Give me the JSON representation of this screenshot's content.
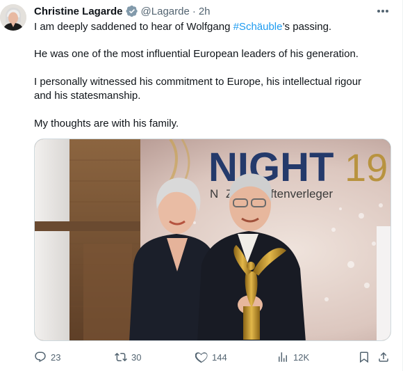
{
  "author": {
    "display_name": "Christine Lagarde",
    "handle": "@Lagarde",
    "separator": "·",
    "time": "2h",
    "avatar_icon": "profile-photo",
    "verified_icon": "verified-badge-icon",
    "verified_color": "#829aab"
  },
  "tweet": {
    "line1_pre": "I am deeply saddened to hear of Wolfgang ",
    "line1_hashtag": "#Schäuble",
    "line1_post": "’s passing.",
    "paragraph2": "He was one of the most influential European leaders of his generation.",
    "paragraph3": "I personally witnessed his commitment to Europe, his intellectual rigour and his statesmanship.",
    "paragraph4": "My thoughts are with his family."
  },
  "media": {
    "banner_word": "NIGHT",
    "banner_number": "19",
    "banner_subtext": "Zeitschriftenverleger",
    "banner_partial": "N"
  },
  "actions": {
    "replies": "23",
    "retweets": "30",
    "likes": "144",
    "views": "12K"
  },
  "colors": {
    "text": "#0f1419",
    "secondary": "#536471",
    "link": "#1d9bf0",
    "banner_navy": "#243a6b",
    "banner_gold": "#b8933f"
  }
}
